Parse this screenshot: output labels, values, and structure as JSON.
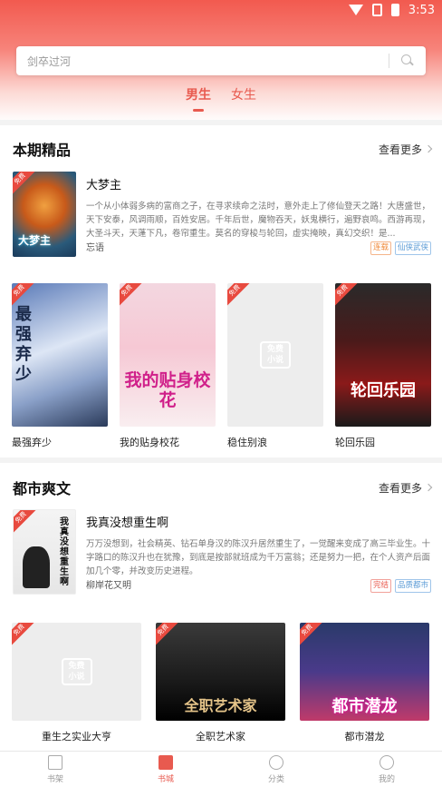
{
  "status_bar": {
    "time": "3:53"
  },
  "search": {
    "placeholder": "剑卒过河"
  },
  "gender_tabs": [
    {
      "label": "男生",
      "active": true
    },
    {
      "label": "女生",
      "active": false
    }
  ],
  "section1": {
    "title": "本期精品",
    "more_label": "查看更多",
    "feature": {
      "badge": "免费",
      "title": "大梦主",
      "cover_text": "大梦主",
      "description": "一个从小体弱多病的富商之子，在寻求续命之法时，意外走上了修仙登天之路！大唐盛世，天下安泰，风调雨顺，百姓安居。千年后世，魔物吞天，妖鬼横行，遍野哀鸣。西游再现，大圣斗天，天蓬下凡，卷帘重生。莫名的穿梭与轮回，虚实掩映，真幻交织！是...",
      "author": "忘语",
      "tags": [
        "连载",
        "仙侠武侠"
      ]
    },
    "grid": [
      {
        "name": "最强弃少",
        "badge": "免费",
        "cover_text": "最强弃少"
      },
      {
        "name": "我的贴身校花",
        "badge": "免费",
        "cover_text": "我的贴身校花"
      },
      {
        "name": "稳住别浪",
        "badge": "免费",
        "placeholder": [
          "免费",
          "小说"
        ]
      },
      {
        "name": "轮回乐园",
        "badge": "免费",
        "cover_text": "轮回乐园"
      }
    ]
  },
  "section2": {
    "title": "都市爽文",
    "more_label": "查看更多",
    "feature": {
      "badge": "免费",
      "title": "我真没想重生啊",
      "cover_text": "我真没想重生啊",
      "description": "万万没想到，社会精英、钻石单身汉的陈汉升居然重生了，一觉醒来变成了高三毕业生。十字路口的陈汉升也在犹豫，到底是按部就班成为千万富翁；还是努力一把，在个人资产后面加几个零，并改变历史进程。",
      "author": "柳岸花又明",
      "tags": [
        "完结",
        "品质都市"
      ]
    },
    "grid": [
      {
        "name": "重生之实业大亨",
        "badge": "免费",
        "placeholder": [
          "免费",
          "小说"
        ]
      },
      {
        "name": "全职艺术家",
        "badge": "免费",
        "cover_text": "全职艺术家"
      },
      {
        "name": "都市潜龙",
        "badge": "免费",
        "cover_text": "都市潜龙"
      }
    ]
  },
  "bottom_nav": [
    {
      "label": "书架",
      "icon": "bookshelf-icon",
      "active": false
    },
    {
      "label": "书城",
      "icon": "bookstore-icon",
      "active": true
    },
    {
      "label": "分类",
      "icon": "category-icon",
      "active": false
    },
    {
      "label": "我的",
      "icon": "profile-icon",
      "active": false
    }
  ],
  "colors": {
    "accent": "#e85a4f",
    "header_top": "#f25a4f"
  }
}
